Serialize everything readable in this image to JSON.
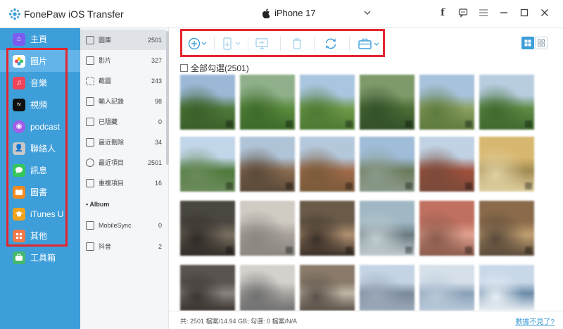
{
  "app": {
    "title": "FonePaw iOS Transfer",
    "device": "iPhone 17",
    "accent": "#3d9ed9",
    "highlight": "#e3262e"
  },
  "sidebar": {
    "items": [
      {
        "label": "主頁",
        "icon": "home-icon",
        "color": "#7b5cf0"
      },
      {
        "label": "圖片",
        "icon": "photos-icon",
        "color": "#f5a623",
        "active": true
      },
      {
        "label": "音樂",
        "icon": "music-icon",
        "color": "#f0435a"
      },
      {
        "label": "視頻",
        "icon": "apple-tv-icon",
        "color": "#111111"
      },
      {
        "label": "podcast",
        "icon": "podcast-icon",
        "color": "#a15ce8"
      },
      {
        "label": "聯絡人",
        "icon": "contacts-icon",
        "color": "#b8b8b8"
      },
      {
        "label": "訊息",
        "icon": "messages-icon",
        "color": "#36c75a"
      },
      {
        "label": "圖書",
        "icon": "books-icon",
        "color": "#f28a1f"
      },
      {
        "label": "iTunes U",
        "icon": "itunes-u-icon",
        "color": "#f1a31c"
      },
      {
        "label": "其他",
        "icon": "other-icon",
        "color": "#f07a4a"
      },
      {
        "label": "工具箱",
        "icon": "toolbox-icon",
        "color": "#45b86c"
      }
    ]
  },
  "categories": {
    "items": [
      {
        "label": "圖庫",
        "count": "2501",
        "active": true
      },
      {
        "label": "影片",
        "count": "327"
      },
      {
        "label": "截圖",
        "count": "243"
      },
      {
        "label": "輸入記錄",
        "count": "98"
      },
      {
        "label": "已隱藏",
        "count": "0"
      },
      {
        "label": "最近刪除",
        "count": "34"
      },
      {
        "label": "最近項目",
        "count": "2501"
      },
      {
        "label": "重複項目",
        "count": "16"
      }
    ],
    "album_header": "Album",
    "albums": [
      {
        "label": "MobileSync",
        "count": "0"
      },
      {
        "label": "抖音",
        "count": "2"
      }
    ]
  },
  "main": {
    "select_all": "全部勾選(2501)",
    "toolbar": [
      "add-icon",
      "export-to-device-icon",
      "export-to-pc-icon",
      "delete-icon",
      "refresh-icon",
      "toolbox-icon"
    ]
  },
  "status": {
    "text": "共: 2501 檔案/14.94 GB; 勾選: 0 檔案/N/A",
    "link": "數據不見了?"
  }
}
